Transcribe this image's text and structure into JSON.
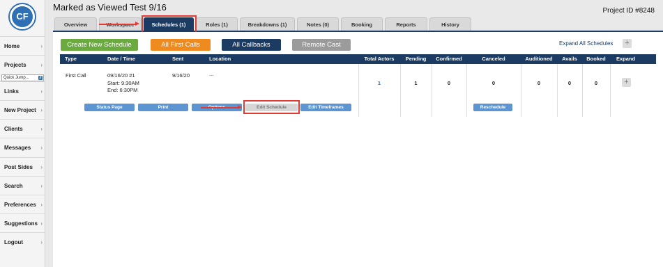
{
  "app": {
    "logo_text": "CF"
  },
  "header": {
    "title": "Marked as Viewed Test 9/16",
    "project_id": "Project ID #8248"
  },
  "sidebar": {
    "quick_jump_placeholder": "Quick Jump...",
    "items": [
      {
        "label": "Home"
      },
      {
        "label": "Projects"
      },
      {
        "label": "Links"
      },
      {
        "label": "New Project"
      },
      {
        "label": "Clients"
      },
      {
        "label": "Messages"
      },
      {
        "label": "Post Sides"
      },
      {
        "label": "Search"
      },
      {
        "label": "Preferences"
      },
      {
        "label": "Suggestions"
      },
      {
        "label": "Logout"
      }
    ]
  },
  "tabs": [
    {
      "label": "Overview"
    },
    {
      "label": "Workspace"
    },
    {
      "label": "Schedules (1)",
      "active": true
    },
    {
      "label": "Roles (1)"
    },
    {
      "label": "Breakdowns (1)"
    },
    {
      "label": "Notes (0)"
    },
    {
      "label": "Booking"
    },
    {
      "label": "Reports"
    },
    {
      "label": "History"
    }
  ],
  "toolbar": {
    "create_new_schedule": "Create New Schedule",
    "all_first_calls": "All First Calls",
    "all_callbacks": "All Callbacks",
    "remote_cast": "Remote Cast",
    "expand_all": "Expand All Schedules",
    "plus": "+"
  },
  "table": {
    "headers": {
      "type": "Type",
      "date_time": "Date / Time",
      "sent": "Sent",
      "location": "Location",
      "total_actors": "Total Actors",
      "pending": "Pending",
      "confirmed": "Confirmed",
      "canceled": "Canceled",
      "auditioned": "Auditioned",
      "avails": "Avails",
      "booked": "Booked",
      "expand": "Expand"
    },
    "row": {
      "type": "First Call",
      "date": "09/16/20 #1",
      "start": "Start: 9:30AM",
      "end": "End: 6:30PM",
      "sent": "9/16/20",
      "location": "...",
      "total_actors": "1",
      "pending": "1",
      "confirmed": "0",
      "canceled": "0",
      "auditioned": "0",
      "avails": "0",
      "booked": "0",
      "expand": "+"
    },
    "actions": {
      "status_page": "Status Page",
      "print": "Print",
      "options": "Options",
      "edit_schedule": "Edit Schedule",
      "edit_timeframes": "Edit Timeframes",
      "reschedule": "Reschedule"
    }
  },
  "colors": {
    "navy": "#1b3b63",
    "green": "#6aaa3f",
    "orange": "#ef8a1e",
    "gray": "#9b9b9b",
    "link_blue": "#2f6fb3",
    "annotation_red": "#e23b34"
  }
}
